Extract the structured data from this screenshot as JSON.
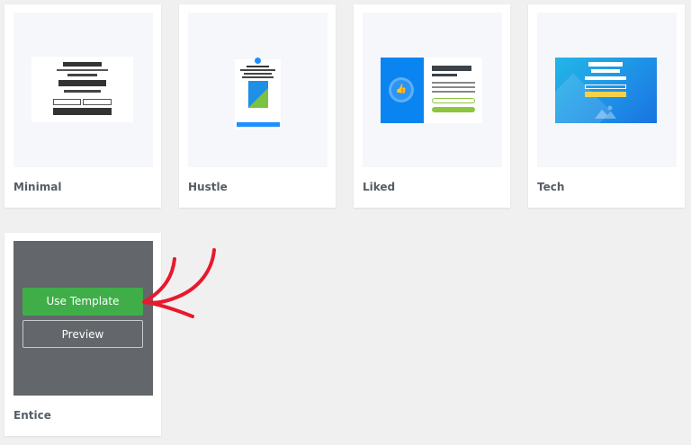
{
  "templates": [
    {
      "name": "Minimal"
    },
    {
      "name": "Hustle"
    },
    {
      "name": "Liked"
    },
    {
      "name": "Tech"
    },
    {
      "name": "Entice"
    }
  ],
  "hover_actions": {
    "use_template_label": "Use Template",
    "preview_label": "Preview"
  },
  "colors": {
    "background": "#f0f0f0",
    "card": "#ffffff",
    "thumb_bg": "#f6f7fb",
    "overlay": "#63666b",
    "use_template": "#3fae49",
    "annotation_arrow": "#e8192c",
    "liked_blue": "#0a84f0",
    "tech_blue": "#1e8fe6",
    "yellow": "#f5d14a",
    "green": "#8cc63f"
  },
  "icons": {
    "liked_thumb": "thumbs-up-icon",
    "tech_image": "image-icon",
    "annotation": "red-arrow"
  }
}
